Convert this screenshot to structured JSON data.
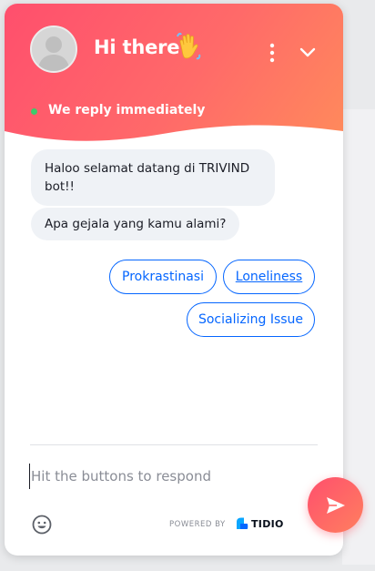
{
  "header": {
    "title": "Hi there",
    "wave_icon": "waving-hand-icon",
    "status": "We reply immediately",
    "status_color": "#3ccb6b",
    "gradient_start": "#ff4f6d",
    "gradient_end": "#ff8b5b"
  },
  "messages": [
    {
      "text": "Haloo selamat datang di TRIVIND bot!!"
    },
    {
      "text": "Apa gejala yang kamu alami?"
    }
  ],
  "quick_replies": [
    {
      "label": "Prokrastinasi"
    },
    {
      "label": "Loneliness"
    },
    {
      "label": "Socializing Issue"
    }
  ],
  "composer": {
    "placeholder": "Hit the buttons to respond"
  },
  "footer": {
    "powered_by": "POWERED BY",
    "brand": "TIDIO"
  },
  "accent_color": "#0566ff"
}
